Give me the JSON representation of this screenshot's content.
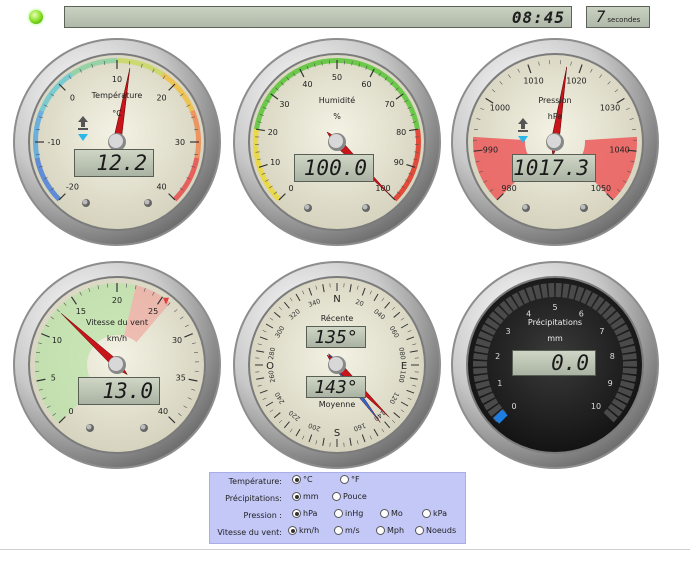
{
  "status": {
    "time": "08:45",
    "seconds_value": "7",
    "seconds_unit": "secondes"
  },
  "colors": {
    "lcd": "#b8c1b0",
    "needle": "#c8141a",
    "led": "#7fdc1e",
    "panel": "#c3c8f7"
  },
  "gauges": {
    "temperature": {
      "title": "Température",
      "unit": "°C",
      "value_text": "12.2",
      "value": 12.2,
      "scale": [
        -20,
        40
      ],
      "ticks": [
        "-20",
        "-10",
        "0",
        "10",
        "20",
        "30",
        "40"
      ],
      "trend_icon": "trend-up-down-icon"
    },
    "humidity": {
      "title": "Humidité",
      "unit": "%",
      "value_text": "100.0",
      "value": 100,
      "scale": [
        0,
        100
      ],
      "ticks": [
        "0",
        "10",
        "20",
        "30",
        "40",
        "50",
        "60",
        "70",
        "80",
        "90",
        "100"
      ]
    },
    "pressure": {
      "title": "Pression",
      "unit": "hPa",
      "value_text": "1017.3",
      "value": 1017.3,
      "scale": [
        980,
        1050
      ],
      "ticks": [
        "980",
        "990",
        "1000",
        "1010",
        "1020",
        "1030",
        "1040",
        "1050"
      ],
      "trend_icon": "trend-up-down-icon"
    },
    "wind": {
      "title": "Vitesse du vent",
      "unit": "km/h",
      "value_text": "13.0",
      "value": 13.0,
      "scale": [
        0,
        40
      ],
      "ticks": [
        "0",
        "5",
        "10",
        "15",
        "20",
        "25",
        "30",
        "35",
        "40"
      ]
    },
    "direction": {
      "recent_label": "Récente",
      "recent_value": "135°",
      "average_label": "Moyenne",
      "average_value": "143°",
      "recent_deg": 135,
      "average_deg": 143,
      "cardinals": [
        "N",
        "E",
        "S",
        "O"
      ],
      "degrees": [
        "20",
        "040",
        "060",
        "080",
        "100",
        "120",
        "140",
        "160",
        "200",
        "220",
        "240",
        "260",
        "280",
        "300",
        "320",
        "340"
      ]
    },
    "rain": {
      "title": "Précipitations",
      "unit": "mm",
      "value_text": "0.0",
      "value": 0,
      "scale": [
        0,
        10
      ],
      "ticks": [
        "0",
        "1",
        "2",
        "3",
        "4",
        "5",
        "6",
        "7",
        "8",
        "9",
        "10"
      ]
    }
  },
  "settings": {
    "temperature": {
      "label": "Température:",
      "options": [
        {
          "label": "°C",
          "selected": true
        },
        {
          "label": "°F",
          "selected": false
        }
      ]
    },
    "precipitation": {
      "label": "Précipitations:",
      "options": [
        {
          "label": "mm",
          "selected": true
        },
        {
          "label": "Pouce",
          "selected": false
        }
      ]
    },
    "pressure": {
      "label": "Pression :",
      "options": [
        {
          "label": "hPa",
          "selected": true
        },
        {
          "label": "inHg",
          "selected": false
        },
        {
          "label": "Mo",
          "selected": false
        },
        {
          "label": "kPa",
          "selected": false
        }
      ]
    },
    "wind": {
      "label": "Vitesse du vent:",
      "options": [
        {
          "label": "km/h",
          "selected": true
        },
        {
          "label": "m/s",
          "selected": false
        },
        {
          "label": "Mph",
          "selected": false
        },
        {
          "label": "Noeuds",
          "selected": false
        }
      ]
    }
  }
}
